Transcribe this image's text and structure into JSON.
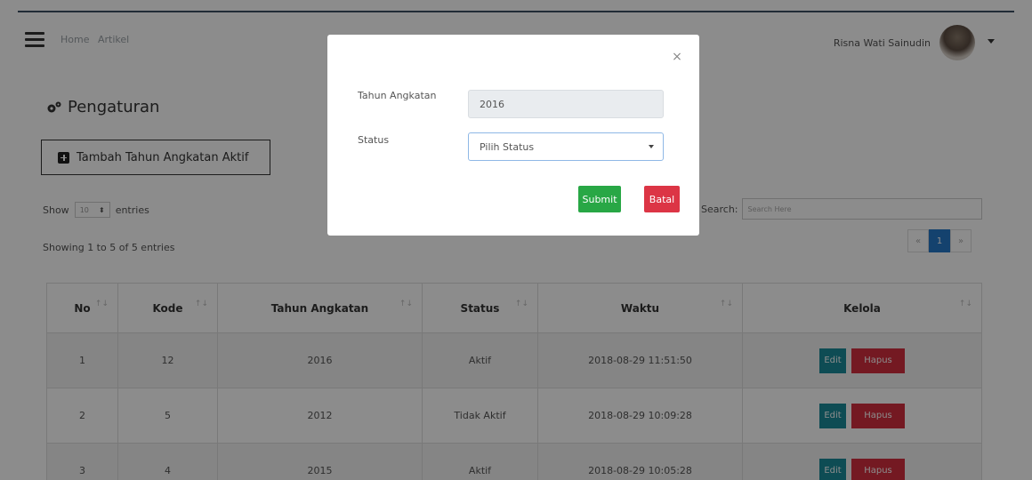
{
  "navbar": {
    "breadcrumb": [
      "Home",
      "Artikel"
    ],
    "user_name": "Risna Wati Sainudin"
  },
  "page": {
    "title": "Pengaturan",
    "add_button": "Tambah Tahun Angkatan Aktif",
    "show_label": "Show",
    "show_value": "10",
    "entries_label": "entries",
    "showing_text": "Showing 1 to 5 of 5 entries",
    "search_label": "Search:",
    "search_placeholder": "Search Here",
    "pagination": {
      "prev": "«",
      "current": "1",
      "next": "»"
    }
  },
  "table": {
    "headers": [
      "No",
      "Kode",
      "Tahun Angkatan",
      "Status",
      "Waktu",
      "Kelola"
    ],
    "sort_glyph": "↑↓",
    "rows": [
      {
        "no": "1",
        "kode": "12",
        "tahun": "2016",
        "status": "Aktif",
        "waktu": "2018-08-29 11:51:50"
      },
      {
        "no": "2",
        "kode": "5",
        "tahun": "2012",
        "status": "Tidak Aktif",
        "waktu": "2018-08-29 10:09:28"
      },
      {
        "no": "3",
        "kode": "4",
        "tahun": "2015",
        "status": "Aktif",
        "waktu": "2018-08-29 10:05:28"
      }
    ],
    "edit_label": "Edit",
    "hapus_label": "Hapus"
  },
  "modal": {
    "close_glyph": "×",
    "tahun_label": "Tahun Angkatan",
    "tahun_value": "2016",
    "status_label": "Status",
    "status_value": "Pilih Status",
    "submit_label": "Submit",
    "batal_label": "Batal"
  },
  "colors": {
    "submit": "#28a745",
    "batal": "#dc3545",
    "edit": "#1a8a9a",
    "hapus": "#d32f3f",
    "pager_active": "#2679c9"
  }
}
